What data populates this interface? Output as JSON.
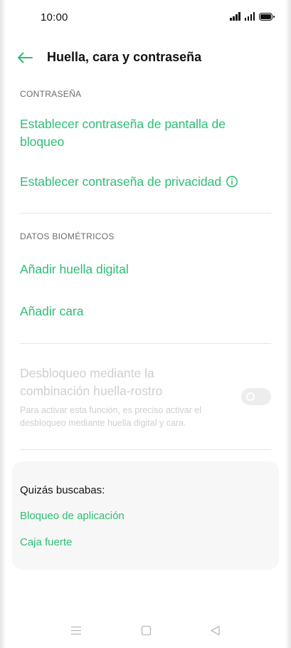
{
  "status_bar": {
    "time": "10:00"
  },
  "header": {
    "title": "Huella, cara y contraseña"
  },
  "password_section": {
    "header": "CONTRASEÑA",
    "lock_screen_label": "Establecer contraseña de pantalla de bloqueo",
    "privacy_label": "Establecer contraseña de privacidad"
  },
  "biometrics_section": {
    "header": "DATOS BIOMÉTRICOS",
    "add_fingerprint_label": "Añadir huella digital",
    "add_face_label": "Añadir cara"
  },
  "combo_unlock": {
    "title": "Desbloqueo mediante la combinación huella-rostro",
    "description": "Para activar esta función, es preciso activar el desbloqueo mediante huella digital y cara.",
    "enabled": false
  },
  "suggestions": {
    "title": "Quizás buscabas:",
    "items": [
      "Bloqueo de aplicación",
      "Caja fuerte"
    ]
  },
  "colors": {
    "accent": "#2bbf73",
    "disabled_text": "#cfcfcf",
    "card_bg": "#f7f7f7"
  },
  "icons": {
    "back": "arrow-left-icon",
    "info": "info-circle-icon",
    "nav_menu": "menu-icon",
    "nav_home": "square-icon",
    "nav_back": "triangle-back-icon"
  }
}
